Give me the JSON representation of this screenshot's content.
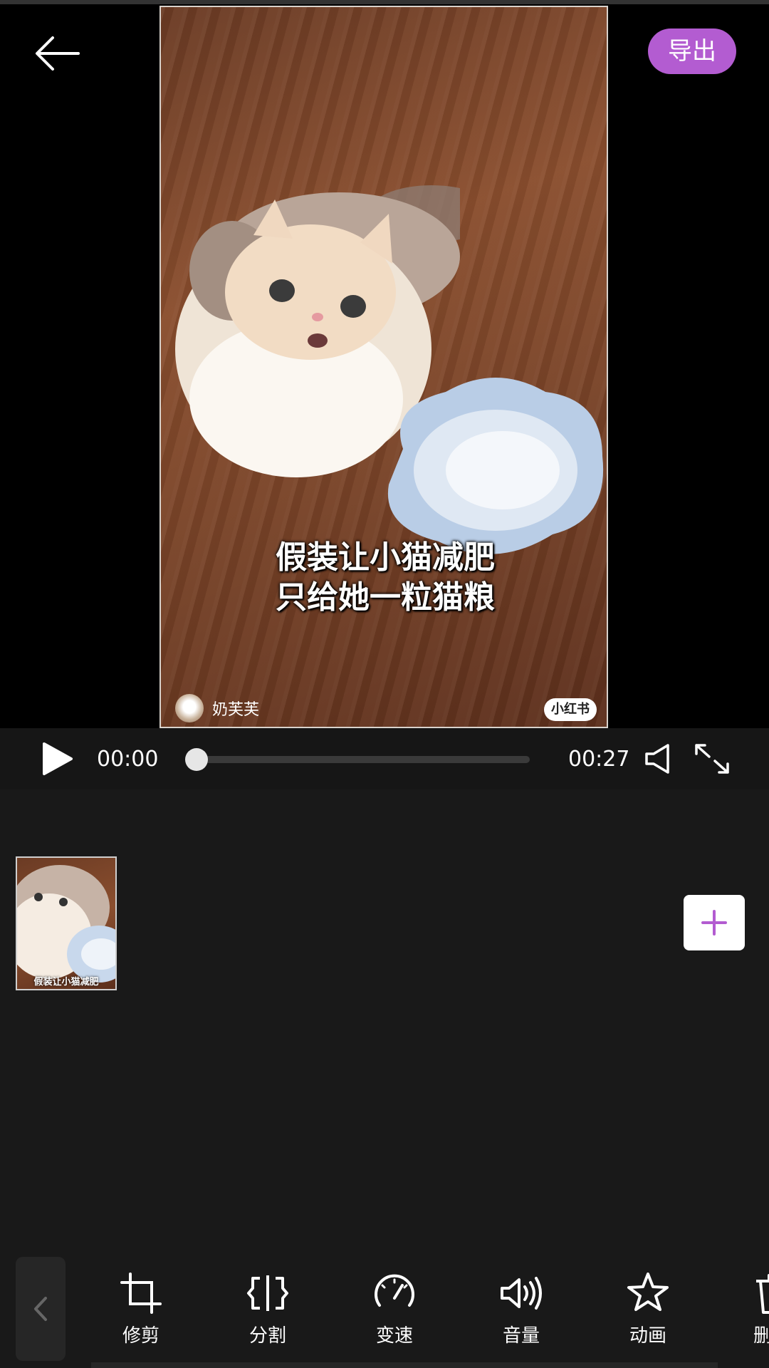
{
  "header": {
    "export_label": "导出"
  },
  "video": {
    "caption_line1": "假装让小猫减肥",
    "caption_line2": "只给她一粒猫粮",
    "author_name": "奶芙芙",
    "platform_badge": "小红书"
  },
  "player": {
    "current_time": "00:00",
    "total_time": "00:27",
    "progress": 0.0
  },
  "timeline": {
    "clip_caption": "假装让小猫减肥"
  },
  "toolbar": {
    "tools": [
      {
        "label": "修剪",
        "icon": "crop-icon"
      },
      {
        "label": "分割",
        "icon": "split-icon"
      },
      {
        "label": "变速",
        "icon": "speed-icon"
      },
      {
        "label": "音量",
        "icon": "volume-icon"
      },
      {
        "label": "动画",
        "icon": "animation-icon"
      },
      {
        "label": "删",
        "icon": "delete-icon"
      }
    ]
  },
  "colors": {
    "accent": "#B35CD1",
    "background": "#191919"
  }
}
